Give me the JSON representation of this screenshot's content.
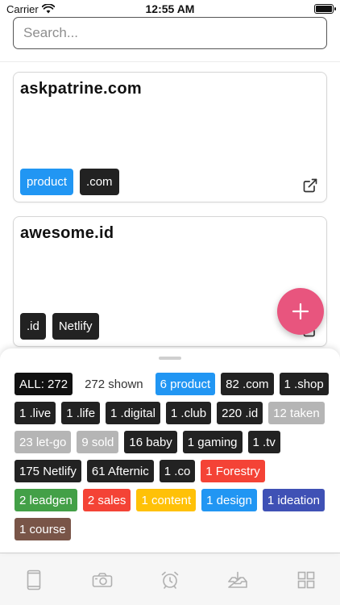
{
  "status_bar": {
    "carrier": "Carrier",
    "time": "12:55 AM"
  },
  "search": {
    "placeholder": "Search..."
  },
  "cards": [
    {
      "title": "askpatrine.com",
      "tags": [
        {
          "label": "product",
          "color": "#2196f3"
        },
        {
          "label": ".com",
          "color": "#222222"
        }
      ]
    },
    {
      "title": "awesome.id",
      "tags": [
        {
          "label": ".id",
          "color": "#222222"
        },
        {
          "label": "Netlify",
          "color": "#222222"
        }
      ]
    }
  ],
  "fab": {
    "icon": "plus-icon",
    "color": "#e8557e"
  },
  "filters": [
    {
      "label": "ALL: 272",
      "color": "#111111"
    },
    {
      "label": "272 shown",
      "color": "transparent"
    },
    {
      "label": "6 product",
      "color": "#2196f3"
    },
    {
      "label": "82 .com",
      "color": "#222222"
    },
    {
      "label": "1 .shop",
      "color": "#222222"
    },
    {
      "label": "1 .live",
      "color": "#222222"
    },
    {
      "label": "1 .life",
      "color": "#222222"
    },
    {
      "label": "1 .digital",
      "color": "#222222"
    },
    {
      "label": "1 .club",
      "color": "#222222"
    },
    {
      "label": "220 .id",
      "color": "#222222"
    },
    {
      "label": "12 taken",
      "color": "#b5b5b5"
    },
    {
      "label": "23 let-go",
      "color": "#b5b5b5"
    },
    {
      "label": "9 sold",
      "color": "#b5b5b5"
    },
    {
      "label": "16 baby",
      "color": "#222222"
    },
    {
      "label": "1 gaming",
      "color": "#222222"
    },
    {
      "label": "1 .tv",
      "color": "#222222"
    },
    {
      "label": "175 Netlify",
      "color": "#222222"
    },
    {
      "label": "61 Afternic",
      "color": "#222222"
    },
    {
      "label": "1 .co",
      "color": "#222222"
    },
    {
      "label": "1 Forestry",
      "color": "#f44336"
    },
    {
      "label": "2 leadgen",
      "color": "#43a047"
    },
    {
      "label": "2 sales",
      "color": "#f44336"
    },
    {
      "label": "1 content",
      "color": "#ffc107"
    },
    {
      "label": "1 design",
      "color": "#2196f3"
    },
    {
      "label": "1 ideation",
      "color": "#3f51b5"
    },
    {
      "label": "1 course",
      "color": "#795548"
    }
  ],
  "tabs": [
    "phone-icon",
    "camera-icon",
    "alarm-clock-icon",
    "inbox-download-icon",
    "grid-icon"
  ],
  "colors": {
    "accent": "#e8557e",
    "tab_icon": "#b0b0b0"
  }
}
